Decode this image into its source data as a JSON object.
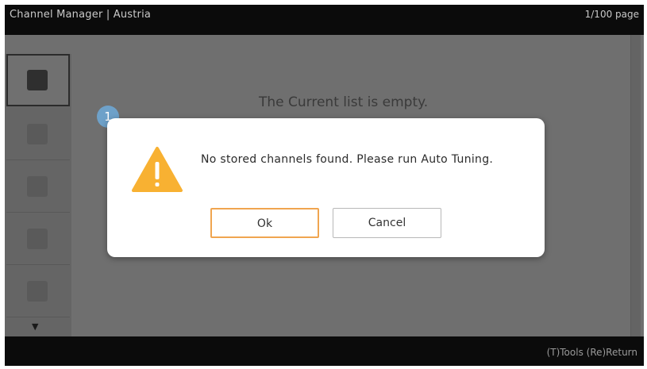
{
  "header": {
    "title": "Channel Manager | Austria",
    "page_info": "1/100 page"
  },
  "main": {
    "empty_message": "The Current list is empty."
  },
  "sidebar": {
    "scroll_down_glyph": "▼"
  },
  "footer": {
    "hints": "(T)Tools  (Re)Return"
  },
  "dialog": {
    "badge": "1",
    "icon": "warning-triangle-icon",
    "message": "No stored channels found. Please run Auto Tuning.",
    "ok_label": "Ok",
    "cancel_label": "Cancel"
  },
  "colors": {
    "warning": "#f8b132",
    "ok_border": "#f0a550",
    "badge": "#6ea1c9"
  }
}
